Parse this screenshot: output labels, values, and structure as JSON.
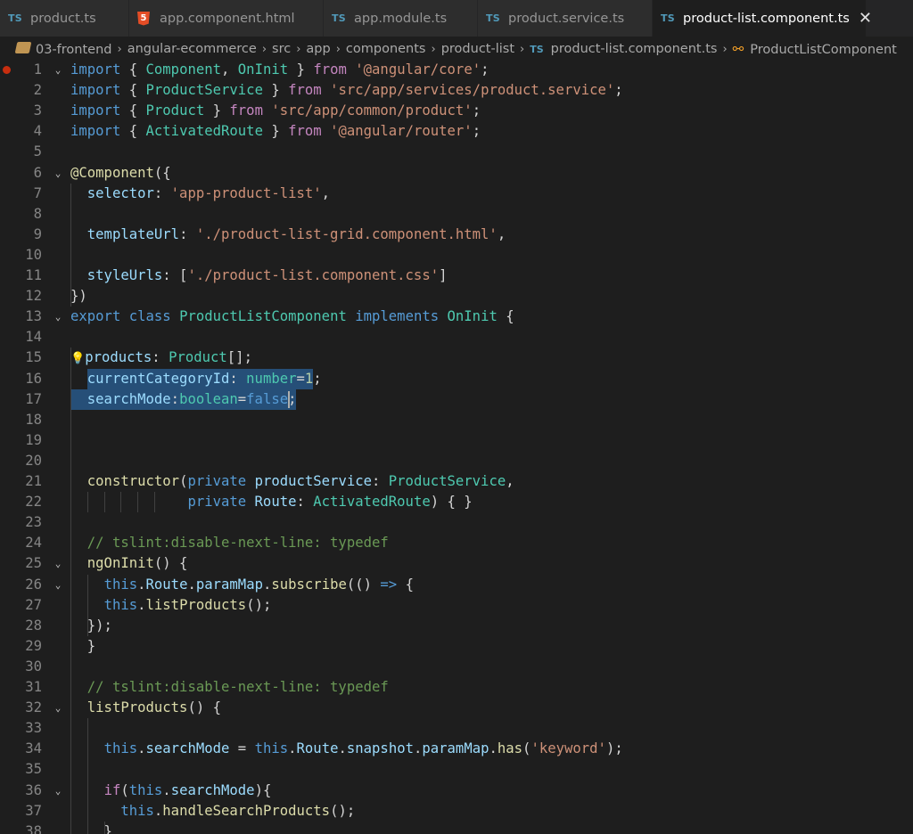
{
  "tabs": [
    {
      "name": "product.ts",
      "type": "ts",
      "active": false
    },
    {
      "name": "app.component.html",
      "type": "html",
      "active": false
    },
    {
      "name": "app.module.ts",
      "type": "ts",
      "active": false
    },
    {
      "name": "product.service.ts",
      "type": "ts",
      "active": false
    },
    {
      "name": "product-list.component.ts",
      "type": "ts",
      "active": true
    }
  ],
  "tab_icon_ts": "TS",
  "tab_icon_html": "5",
  "close_glyph": "✕",
  "breadcrumb": [
    {
      "label": "03-frontend",
      "icon": "folder-icon"
    },
    {
      "label": "angular-ecommerce"
    },
    {
      "label": "src"
    },
    {
      "label": "app"
    },
    {
      "label": "components"
    },
    {
      "label": "product-list"
    },
    {
      "label": "product-list.component.ts",
      "icon": "ts-file-icon"
    },
    {
      "label": "ProductListComponent",
      "icon": "class-symbol-icon"
    }
  ],
  "colors": {
    "keyword": "#569cd6",
    "control": "#c586c0",
    "type": "#4ec9b0",
    "variable": "#9cdcfe",
    "string": "#ce9178",
    "number": "#b5cea8",
    "function": "#dcdcaa",
    "comment": "#6a9955",
    "selection": "#264f78",
    "breakpoint": "#c72e0f"
  },
  "code_lines": [
    {
      "n": "1",
      "fold": true,
      "bp": true,
      "tokens": [
        [
          "kw",
          "import"
        ],
        [
          "pun",
          " { "
        ],
        [
          "ty",
          "Component"
        ],
        [
          "pun",
          ", "
        ],
        [
          "ty",
          "OnInit"
        ],
        [
          "pun",
          " } "
        ],
        [
          "ctl",
          "from"
        ],
        [
          "pun",
          " "
        ],
        [
          "str",
          "'@angular/core'"
        ],
        [
          "pun",
          ";"
        ]
      ]
    },
    {
      "n": "2",
      "tokens": [
        [
          "kw",
          "import"
        ],
        [
          "pun",
          " { "
        ],
        [
          "ty",
          "ProductService"
        ],
        [
          "pun",
          " } "
        ],
        [
          "ctl",
          "from"
        ],
        [
          "pun",
          " "
        ],
        [
          "str",
          "'src/app/services/product.service'"
        ],
        [
          "pun",
          ";"
        ]
      ]
    },
    {
      "n": "3",
      "tokens": [
        [
          "kw",
          "import"
        ],
        [
          "pun",
          " { "
        ],
        [
          "ty",
          "Product"
        ],
        [
          "pun",
          " } "
        ],
        [
          "ctl",
          "from"
        ],
        [
          "pun",
          " "
        ],
        [
          "str",
          "'src/app/common/product'"
        ],
        [
          "pun",
          ";"
        ]
      ]
    },
    {
      "n": "4",
      "tokens": [
        [
          "kw",
          "import"
        ],
        [
          "pun",
          " { "
        ],
        [
          "ty",
          "ActivatedRoute"
        ],
        [
          "pun",
          " } "
        ],
        [
          "ctl",
          "from"
        ],
        [
          "pun",
          " "
        ],
        [
          "str",
          "'@angular/router'"
        ],
        [
          "pun",
          ";"
        ]
      ]
    },
    {
      "n": "5",
      "tokens": []
    },
    {
      "n": "6",
      "fold": true,
      "tokens": [
        [
          "dec",
          "@Component"
        ],
        [
          "pun",
          "({"
        ]
      ]
    },
    {
      "n": "7",
      "tokens": [
        [
          "pun",
          "  "
        ],
        [
          "va",
          "selector"
        ],
        [
          "pun",
          ": "
        ],
        [
          "str",
          "'app-product-list'"
        ],
        [
          "pun",
          ","
        ]
      ]
    },
    {
      "n": "8",
      "tokens": []
    },
    {
      "n": "9",
      "tokens": [
        [
          "pun",
          "  "
        ],
        [
          "va",
          "templateUrl"
        ],
        [
          "pun",
          ": "
        ],
        [
          "str",
          "'./product-list-grid.component.html'"
        ],
        [
          "pun",
          ","
        ]
      ]
    },
    {
      "n": "10",
      "tokens": []
    },
    {
      "n": "11",
      "tokens": [
        [
          "pun",
          "  "
        ],
        [
          "va",
          "styleUrls"
        ],
        [
          "pun",
          ": ["
        ],
        [
          "str",
          "'./product-list.component.css'"
        ],
        [
          "pun",
          "]"
        ]
      ]
    },
    {
      "n": "12",
      "tokens": [
        [
          "pun",
          "})"
        ]
      ]
    },
    {
      "n": "13",
      "fold": true,
      "tokens": [
        [
          "kw",
          "export"
        ],
        [
          "pun",
          " "
        ],
        [
          "kw",
          "class"
        ],
        [
          "pun",
          " "
        ],
        [
          "ty",
          "ProductListComponent"
        ],
        [
          "pun",
          " "
        ],
        [
          "kw",
          "implements"
        ],
        [
          "pun",
          " "
        ],
        [
          "ty",
          "OnInit"
        ],
        [
          "pun",
          " {"
        ]
      ]
    },
    {
      "n": "14",
      "tokens": []
    },
    {
      "n": "15",
      "bulb": true,
      "tokens": [
        [
          "va",
          "products"
        ],
        [
          "pun",
          ": "
        ],
        [
          "ty",
          "Product"
        ],
        [
          "pun",
          "[];"
        ]
      ]
    },
    {
      "n": "16",
      "tokens": [
        [
          "pun",
          "  "
        ],
        [
          "va",
          "currentCategoryId"
        ],
        [
          "pun",
          ": "
        ],
        [
          "ty",
          "number"
        ],
        [
          "pun",
          "="
        ],
        [
          "num",
          "1"
        ],
        [
          "pun",
          ";"
        ]
      ]
    },
    {
      "n": "17",
      "tokens": [
        [
          "pun",
          "  "
        ],
        [
          "va",
          "searchMode"
        ],
        [
          "pun",
          ":"
        ],
        [
          "ty",
          "boolean"
        ],
        [
          "pun",
          "="
        ],
        [
          "kw",
          "false"
        ],
        [
          "pun",
          ";"
        ]
      ]
    },
    {
      "n": "18",
      "tokens": []
    },
    {
      "n": "19",
      "tokens": []
    },
    {
      "n": "20",
      "tokens": []
    },
    {
      "n": "21",
      "tokens": [
        [
          "pun",
          "  "
        ],
        [
          "fn",
          "constructor"
        ],
        [
          "pun",
          "("
        ],
        [
          "kw",
          "private"
        ],
        [
          "pun",
          " "
        ],
        [
          "va",
          "productService"
        ],
        [
          "pun",
          ": "
        ],
        [
          "ty",
          "ProductService"
        ],
        [
          "pun",
          ","
        ]
      ]
    },
    {
      "n": "22",
      "tokens": [
        [
          "pun",
          "              "
        ],
        [
          "kw",
          "private"
        ],
        [
          "pun",
          " "
        ],
        [
          "va",
          "Route"
        ],
        [
          "pun",
          ": "
        ],
        [
          "ty",
          "ActivatedRoute"
        ],
        [
          "pun",
          ") { }"
        ]
      ]
    },
    {
      "n": "23",
      "tokens": []
    },
    {
      "n": "24",
      "tokens": [
        [
          "pun",
          "  "
        ],
        [
          "com",
          "// tslint:disable-next-line: typedef"
        ]
      ]
    },
    {
      "n": "25",
      "fold": true,
      "tokens": [
        [
          "pun",
          "  "
        ],
        [
          "fn",
          "ngOnInit"
        ],
        [
          "pun",
          "() {"
        ]
      ]
    },
    {
      "n": "26",
      "fold": true,
      "tokens": [
        [
          "pun",
          "    "
        ],
        [
          "kw",
          "this"
        ],
        [
          "pun",
          "."
        ],
        [
          "va",
          "Route"
        ],
        [
          "pun",
          "."
        ],
        [
          "va",
          "paramMap"
        ],
        [
          "pun",
          "."
        ],
        [
          "fn",
          "subscribe"
        ],
        [
          "pun",
          "(() "
        ],
        [
          "kw",
          "=>"
        ],
        [
          "pun",
          " {"
        ]
      ]
    },
    {
      "n": "27",
      "tokens": [
        [
          "pun",
          "    "
        ],
        [
          "kw",
          "this"
        ],
        [
          "pun",
          "."
        ],
        [
          "fn",
          "listProducts"
        ],
        [
          "pun",
          "();"
        ]
      ]
    },
    {
      "n": "28",
      "tokens": [
        [
          "pun",
          "  });"
        ]
      ]
    },
    {
      "n": "29",
      "tokens": [
        [
          "pun",
          "  }"
        ]
      ]
    },
    {
      "n": "30",
      "tokens": []
    },
    {
      "n": "31",
      "tokens": [
        [
          "pun",
          "  "
        ],
        [
          "com",
          "// tslint:disable-next-line: typedef"
        ]
      ]
    },
    {
      "n": "32",
      "fold": true,
      "tokens": [
        [
          "pun",
          "  "
        ],
        [
          "fn",
          "listProducts"
        ],
        [
          "pun",
          "() {"
        ]
      ]
    },
    {
      "n": "33",
      "tokens": []
    },
    {
      "n": "34",
      "tokens": [
        [
          "pun",
          "    "
        ],
        [
          "kw",
          "this"
        ],
        [
          "pun",
          "."
        ],
        [
          "va",
          "searchMode"
        ],
        [
          "pun",
          " = "
        ],
        [
          "kw",
          "this"
        ],
        [
          "pun",
          "."
        ],
        [
          "va",
          "Route"
        ],
        [
          "pun",
          "."
        ],
        [
          "va",
          "snapshot"
        ],
        [
          "pun",
          "."
        ],
        [
          "va",
          "paramMap"
        ],
        [
          "pun",
          "."
        ],
        [
          "fn",
          "has"
        ],
        [
          "pun",
          "("
        ],
        [
          "str",
          "'keyword'"
        ],
        [
          "pun",
          ");"
        ]
      ]
    },
    {
      "n": "35",
      "tokens": []
    },
    {
      "n": "36",
      "fold": true,
      "tokens": [
        [
          "pun",
          "    "
        ],
        [
          "ctl",
          "if"
        ],
        [
          "pun",
          "("
        ],
        [
          "kw",
          "this"
        ],
        [
          "pun",
          "."
        ],
        [
          "va",
          "searchMode"
        ],
        [
          "pun",
          "){"
        ]
      ]
    },
    {
      "n": "37",
      "tokens": [
        [
          "pun",
          "      "
        ],
        [
          "kw",
          "this"
        ],
        [
          "pun",
          "."
        ],
        [
          "fn",
          "handleSearchProducts"
        ],
        [
          "pun",
          "();"
        ]
      ]
    },
    {
      "n": "38",
      "tokens": [
        [
          "pun",
          "    }"
        ]
      ]
    }
  ]
}
